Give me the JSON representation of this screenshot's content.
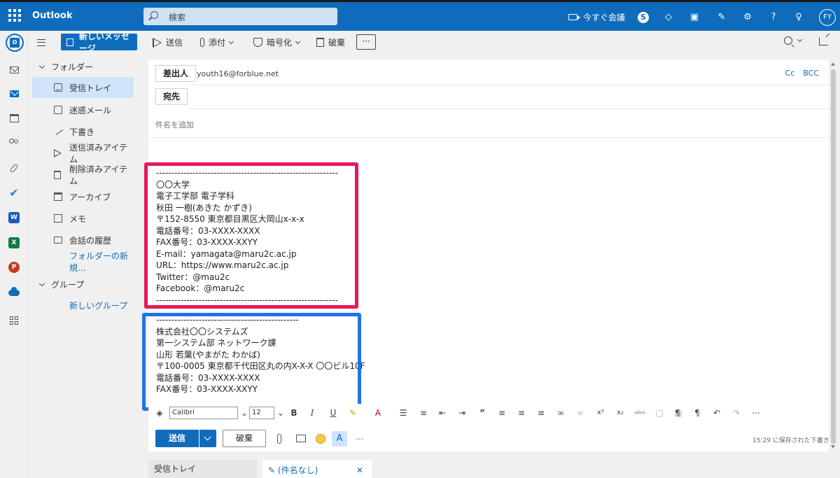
{
  "app": {
    "name": "Outlook"
  },
  "search": {
    "placeholder": "検索"
  },
  "topbar": {
    "meet_now": "今すぐ会議",
    "avatar_initials": "FY"
  },
  "folders": {
    "new_message": "新しいメッセージ",
    "section_folders": "フォルダー",
    "items": [
      {
        "label": "受信トレイ",
        "icon": "inbox-icon",
        "selected": true
      },
      {
        "label": "迷惑メール",
        "icon": "junk-icon"
      },
      {
        "label": "下書き",
        "icon": "draft-icon"
      },
      {
        "label": "送信済みアイテム",
        "icon": "sent-icon"
      },
      {
        "label": "削除済みアイテム",
        "icon": "trash-icon"
      },
      {
        "label": "アーカイブ",
        "icon": "archive-icon"
      },
      {
        "label": "メモ",
        "icon": "note-icon"
      },
      {
        "label": "会話の履歴",
        "icon": "folder-icon"
      }
    ],
    "new_folder": "フォルダーの新規...",
    "section_groups": "グループ",
    "new_group": "新しいグループ"
  },
  "commands": {
    "send": "送信",
    "attach": "添付",
    "encrypt": "暗号化",
    "discard": "破棄",
    "more": "···"
  },
  "compose": {
    "from_label": "差出人",
    "from_value": "youth16@forblue.net",
    "to_label": "宛先",
    "cc": "Cc",
    "bcc": "BCC",
    "subject_placeholder": "件名を追加",
    "signature1": [
      "------------------------------------------------------------",
      "〇〇大学",
      "電子工学部 電子学科",
      "秋田 一樹(あきた かずき)",
      "〒152-8550 東京都目黒区大岡山x-x-x",
      "電話番号：03-XXXX-XXXX",
      "FAX番号：03-XXXX-XXYY",
      "E-mail：yamagata@maru2c.ac.jp",
      "URL：https://www.maru2c.ac.jp",
      "Twitter：@mau2c",
      "Facebook：@maru2c",
      "------------------------------------------------------------"
    ],
    "signature2": [
      "-----------------------------------------------",
      "株式会社〇〇システムズ",
      "第一システム部 ネットワーク課",
      "山形 若葉(やまがた わかば)",
      "〒100-0005 東京都千代田区丸の内X-X-X 〇〇ビル10F",
      "電話番号：03-XXXX-XXXX",
      "FAX番号：03-XXXX-XXYY"
    ]
  },
  "format": {
    "font": "Calibri",
    "size": "12"
  },
  "send_row": {
    "send": "送信",
    "discard": "破棄",
    "saved": "15:29 に保存された下書き"
  },
  "tabs": {
    "inbox": "受信トレイ",
    "draft": "(件名なし)"
  },
  "colors": {
    "brand": "#0f6cbd",
    "highlight_red": "#e5195f",
    "highlight_blue": "#1e73e8"
  }
}
